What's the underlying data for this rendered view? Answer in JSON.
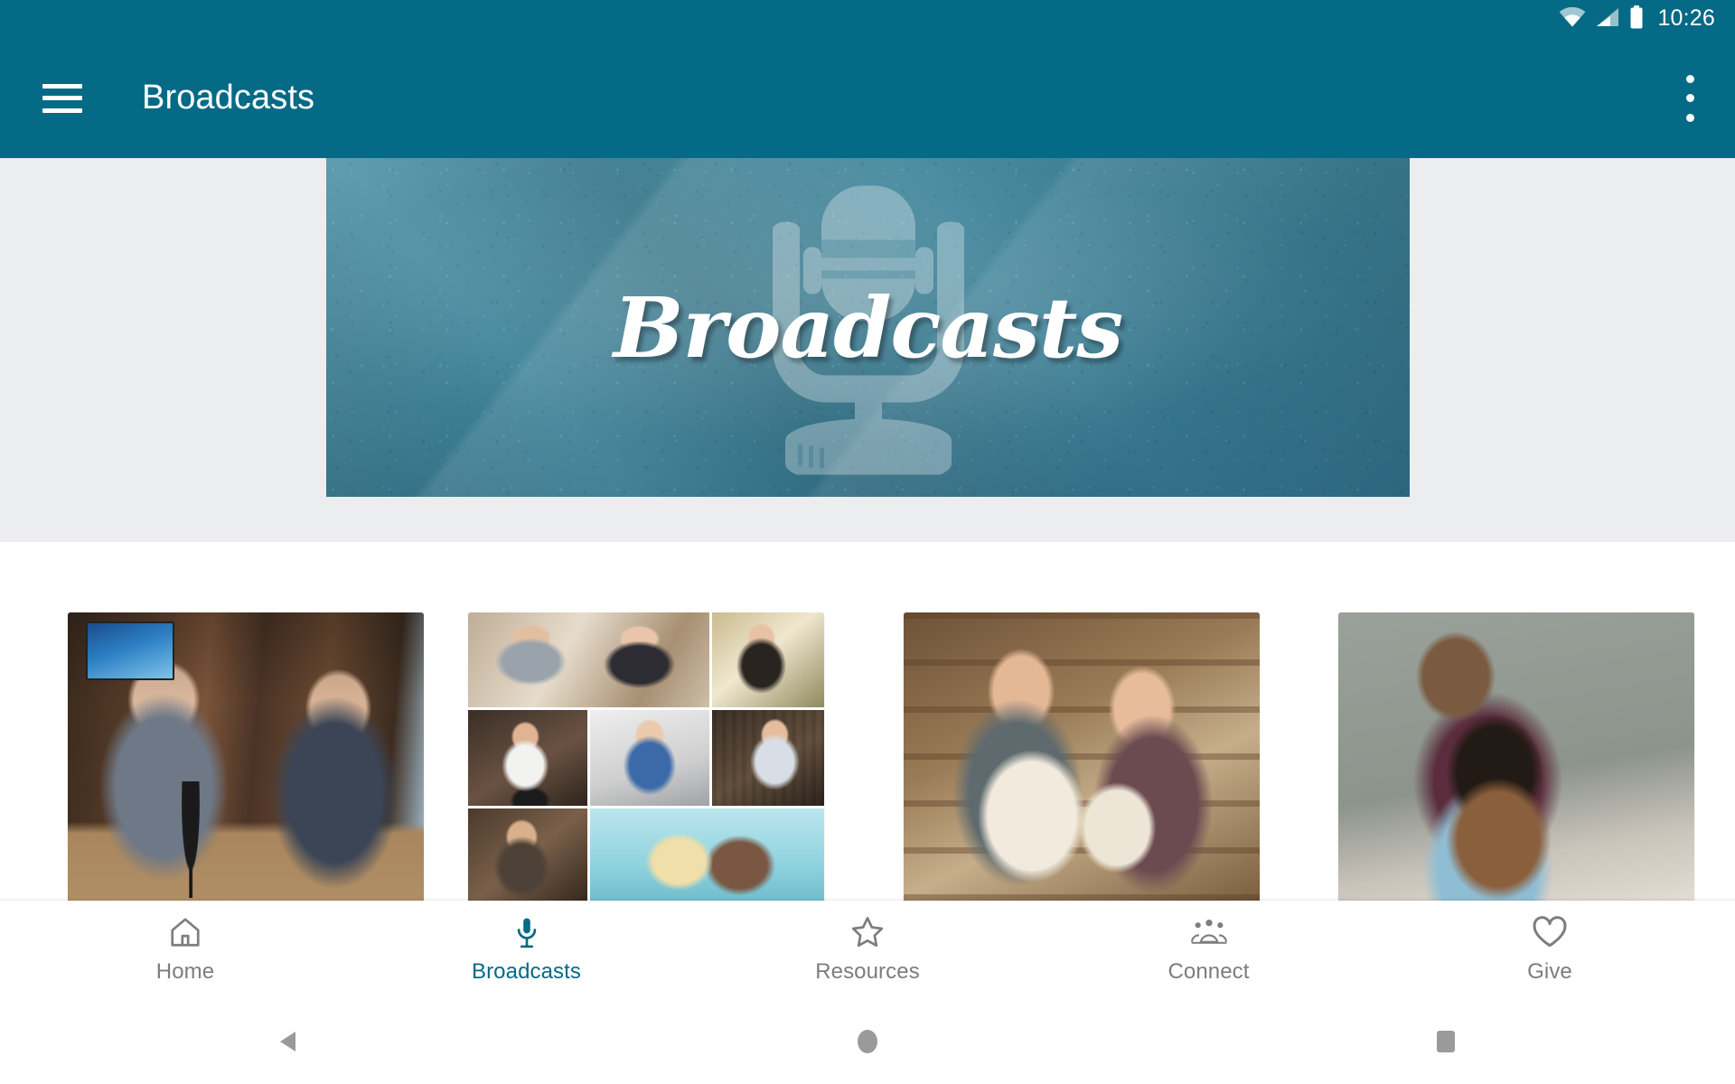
{
  "status_bar": {
    "time": "10:26",
    "icons": [
      "wifi-icon",
      "cellular-signal-icon",
      "battery-icon"
    ]
  },
  "app_bar": {
    "menu_icon": "hamburger-menu-icon",
    "title": "Broadcasts",
    "overflow_icon": "overflow-menu-icon"
  },
  "hero": {
    "title": "Broadcasts",
    "illustration": "microphone-icon",
    "background_color": "#3E8298"
  },
  "cards": [
    {
      "name": "card-studio-interview",
      "alt": "Two men seated at a studio desk with microphones"
    },
    {
      "name": "card-headshot-collage",
      "alt": "Grid collage of broadcast host headshots"
    },
    {
      "name": "card-pottery-couple",
      "alt": "Couple laughing in a pottery workshop holding bowls"
    },
    {
      "name": "card-father-daughter",
      "alt": "Father and young daughter sitting on a couch"
    }
  ],
  "bottom_nav": {
    "active_color": "#056A86",
    "inactive_color": "#7D7D7D",
    "items": [
      {
        "label": "Home",
        "icon": "home-icon",
        "active": false
      },
      {
        "label": "Broadcasts",
        "icon": "microphone-icon",
        "active": true
      },
      {
        "label": "Resources",
        "icon": "star-icon",
        "active": false
      },
      {
        "label": "Connect",
        "icon": "people-group-icon",
        "active": false
      },
      {
        "label": "Give",
        "icon": "heart-icon",
        "active": false
      }
    ]
  },
  "system_nav": {
    "buttons": [
      {
        "name": "back-button",
        "icon": "triangle-left-icon"
      },
      {
        "name": "home-button",
        "icon": "circle-icon"
      },
      {
        "name": "recents-button",
        "icon": "square-icon"
      }
    ]
  },
  "theme": {
    "primary": "#056A86",
    "carousel_band": "#ECEDEE",
    "page_background": "#FFFFFF"
  }
}
